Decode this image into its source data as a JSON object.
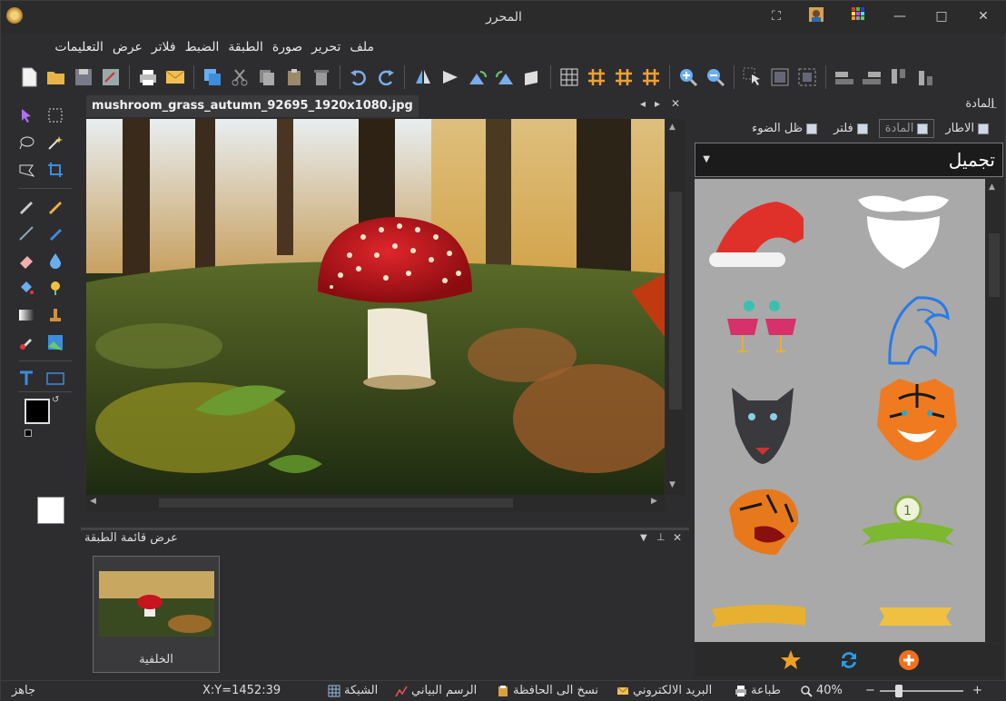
{
  "window": {
    "title": "المحرر",
    "controls": [
      "⛶",
      "□",
      "—",
      "✕"
    ]
  },
  "menu": [
    "ملف",
    "تحرير",
    "صورة",
    "الطبقة",
    "الضبط",
    "فلاتر",
    "عرض",
    "التعليمات"
  ],
  "document": {
    "tab_title": "mushroom_grass_autumn_92695_1920x1080.jpg",
    "ctl_prev": "◂",
    "ctl_next": "▸",
    "ctl_close": "✕"
  },
  "layers": {
    "title": "عرض قائمة الطبقة",
    "items": [
      {
        "name": "الخلفية"
      }
    ]
  },
  "right_panel": {
    "title": "المادة",
    "tabs": [
      "الاطار",
      "المادة",
      "فلتر",
      "ظل الضوء"
    ],
    "active_tab": "المادة",
    "category": "تجميل",
    "items": [
      "santa-hat",
      "beard-mustache",
      "party-glasses",
      "blue-eagle",
      "wolf-head",
      "tiger-head",
      "tiger-roar",
      "green-ribbon-badge",
      "gold-ribbon",
      "gold-banner"
    ]
  },
  "status": {
    "ready": "جاهز",
    "coords": "X:Y=1452:39",
    "grid": "الشبكة",
    "chart": "الرسم البياني",
    "copy": "نسخ الى الحافظة",
    "email": "البريد الالكتروني",
    "print": "طباعة",
    "zoom": "40%",
    "zoom_minus": "−",
    "zoom_plus": "+"
  },
  "colors": {
    "accent": "#3c8dde",
    "mushroom_red": "#c8141c",
    "foreground_swatch": "#000000",
    "background_swatch": "#ffffff"
  }
}
